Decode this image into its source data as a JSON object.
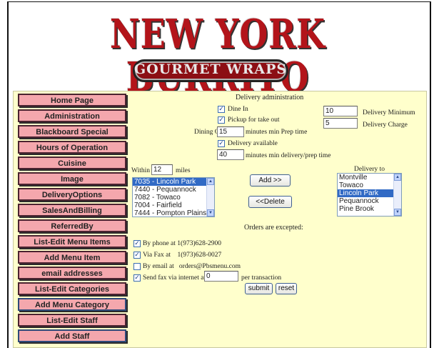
{
  "header": {
    "logo_title": "NEW YORK BURRITO",
    "logo_subtitle": "GOURMET WRAPS"
  },
  "nav": [
    {
      "label": "Home Page"
    },
    {
      "label": "Administration"
    },
    {
      "label": "Blackboard Special"
    },
    {
      "label": "Hours of Operation"
    },
    {
      "label": "Cuisine"
    },
    {
      "label": "Image"
    },
    {
      "label": "DeliveryOptions"
    },
    {
      "label": "SalesAndBilling"
    },
    {
      "label": "ReferredBy"
    },
    {
      "label": "List-Edit Menu Items"
    },
    {
      "label": "Add Menu Item"
    },
    {
      "label": "email addresses"
    },
    {
      "label": "List-Edit Categories"
    },
    {
      "label": "Add Menu Category"
    },
    {
      "label": "List-Edit Staff"
    },
    {
      "label": "Add Staff"
    }
  ],
  "delivery": {
    "title": "Delivery administration",
    "dine_in": {
      "label": "Dine In",
      "checked": true
    },
    "pickup": {
      "label": "Pickup for take out",
      "checked": true
    },
    "dining_options_label": "Dining Options:",
    "prep_time_value": "15",
    "prep_time_label": "minutes min Prep time",
    "delivery_available": {
      "label": "Delivery available",
      "checked": true
    },
    "delivery_prep_value": "40",
    "delivery_prep_label": "minutes min delivery/prep time",
    "delivery_minimum_value": "10",
    "delivery_minimum_label": "Delivery Minimum",
    "delivery_charge_value": "5",
    "delivery_charge_label": "Delivery Charge",
    "within_label": "Within",
    "within_value": "12",
    "miles_label": "miles",
    "available_towns": [
      "7035 - Lincoln Park",
      "7440 - Pequannock",
      "7082 - Towaco",
      "7004 - Fairfield",
      "7444 - Pompton Plains"
    ],
    "add_button": "Add >>",
    "delete_button": "<<Delete",
    "delivery_to_label": "Delivery to",
    "delivery_to_towns": [
      "Montville",
      "Towaco",
      "Lincoln Park",
      "Pequannock",
      "Pine Brook"
    ]
  },
  "orders": {
    "title": "Orders are excepted:",
    "by_phone": {
      "label": "By phone at 1(973)628-2900",
      "checked": true
    },
    "via_fax": {
      "label": "Via Fax at    1(973)628-0027",
      "checked": true
    },
    "by_email": {
      "label": "By email at   orders@Pbsmenu.com",
      "checked": false
    },
    "send_fax": {
      "label": "Send fax via internet at:",
      "checked": true
    },
    "fax_value": "0",
    "per_transaction_label": "per transaction",
    "submit_button": "submit",
    "reset_button": "reset"
  },
  "colors": {
    "nav_button": "#f4a7ad",
    "panel": "#ffffcc",
    "logo_red": "#b3141a",
    "selected": "#316ac5"
  }
}
